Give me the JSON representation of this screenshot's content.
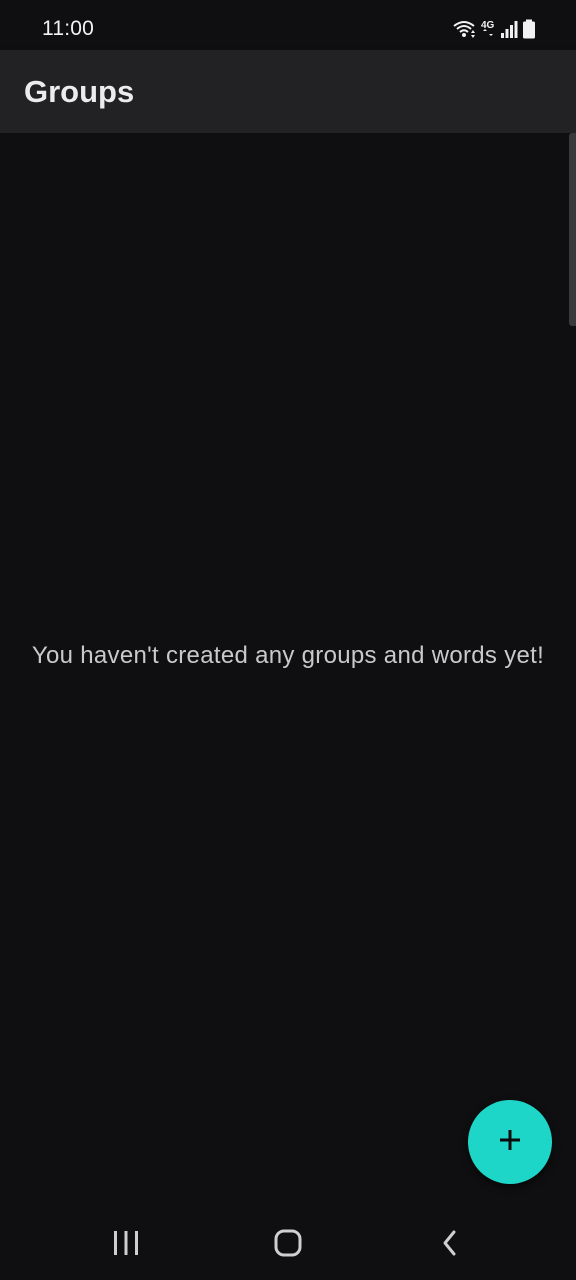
{
  "status_bar": {
    "time": "11:00",
    "icons": [
      "wifi-icon",
      "4g-icon",
      "signal-icon",
      "battery-icon"
    ],
    "network_label": "4G"
  },
  "app_bar": {
    "title": "Groups"
  },
  "content": {
    "empty_message": "You haven't created any groups and words yet!"
  },
  "fab": {
    "icon": "plus-icon",
    "color": "#1ed6c8"
  },
  "nav_bar": {
    "icons": [
      "recents-icon",
      "home-icon",
      "back-icon"
    ]
  },
  "colors": {
    "background": "#0f0f11",
    "app_bar": "#222224",
    "accent": "#1ed6c8"
  }
}
